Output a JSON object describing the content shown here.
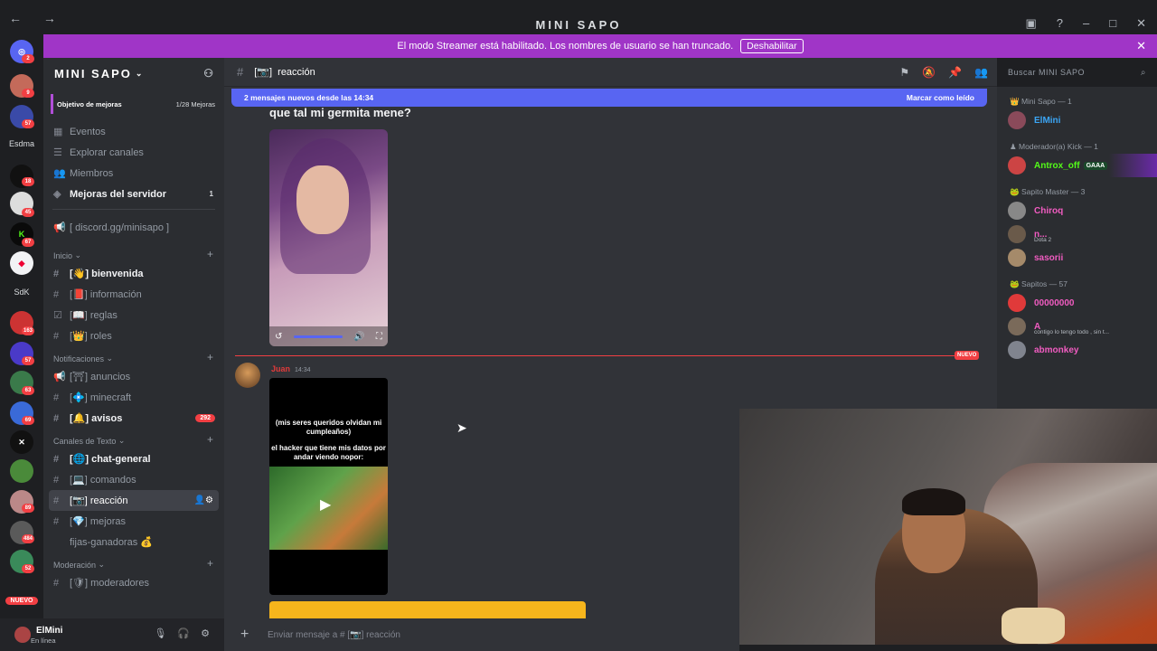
{
  "window": {
    "title": "MINI SAPO"
  },
  "banner": {
    "text": "El modo Streamer está habilitado. Los nombres de usuario se han truncado.",
    "button": "Deshabilitar"
  },
  "guilds": {
    "badges": [
      "2",
      "9",
      "57",
      "",
      "",
      "18",
      "45",
      "67",
      "",
      "",
      "163",
      "57",
      "63",
      "69",
      "",
      "",
      "89",
      "484",
      "52"
    ],
    "labels": {
      "esdma": "Esdma",
      "sdk": "SdK",
      "nuevo": "NUEVO"
    }
  },
  "server": {
    "name": "MINI SAPO",
    "boost_label": "Objetivo de mejoras",
    "boost_count": "1/28 Mejoras",
    "items": [
      {
        "label": "Eventos"
      },
      {
        "label": "Explorar canales"
      },
      {
        "label": "Miembros"
      },
      {
        "label": "Mejoras del servidor",
        "count": "1"
      }
    ],
    "invite_channel": "[ discord.gg/minisapo ]",
    "categories": {
      "inicio": "Inicio",
      "notificaciones": "Notificaciones",
      "texto": "Canales de Texto",
      "moderacion": "Moderación"
    },
    "channels_inicio": [
      "bienvenida",
      "información",
      "reglas",
      "roles"
    ],
    "channels_notif": [
      "anuncios",
      "minecraft",
      "avisos"
    ],
    "avisos_badge": "292",
    "channels_texto": [
      "chat-general",
      "comandos",
      "reacción",
      "mejoras",
      "fijas-ganadoras"
    ],
    "channels_mod": [
      "moderadores"
    ]
  },
  "user": {
    "name": "ElMini",
    "status": "En línea"
  },
  "channel": {
    "name": "reacción"
  },
  "search": {
    "placeholder": "Buscar MINI SAPO"
  },
  "newbar": {
    "text": "2 mensajes nuevos desde las 14:34",
    "action": "Marcar como leído"
  },
  "messages": {
    "first_text": "que tal mi germita mene?",
    "new_tag": "NUEVO",
    "author": "Juan",
    "time": "14:34",
    "video_caption_1": "(mis seres queridos olvidan mi cumpleaños)",
    "video_caption_2": "el hacker que tiene mis datos por andar viendo nopor:"
  },
  "composer": {
    "placeholder": "Enviar mensaje a # [📷] reacción"
  },
  "members": {
    "groups": [
      {
        "title": "Mini Sapo — 1",
        "rows": [
          {
            "name": "ElMini",
            "color": "#3ba6f5"
          }
        ]
      },
      {
        "title": "Moderador(a) Kick — 1",
        "rows": [
          {
            "name": "Antrox_off",
            "color": "#53fc18",
            "tag": "GAAA"
          }
        ]
      },
      {
        "title": "Sapito Master — 3",
        "rows": [
          {
            "name": "Chiroq",
            "color": "#f15cc1"
          },
          {
            "name": "n...",
            "color": "#f15cc1",
            "sub": "Dota 2"
          },
          {
            "name": "sasorii",
            "color": "#f15cc1"
          }
        ]
      },
      {
        "title": "Sapitos — 57",
        "rows": [
          {
            "name": "00000000",
            "color": "#f15cc1"
          },
          {
            "name": "A",
            "color": "#f15cc1",
            "sub": "contigo lo tengo todo , sin t..."
          },
          {
            "name": "abmonkey",
            "color": "#f15cc1"
          }
        ]
      }
    ]
  }
}
